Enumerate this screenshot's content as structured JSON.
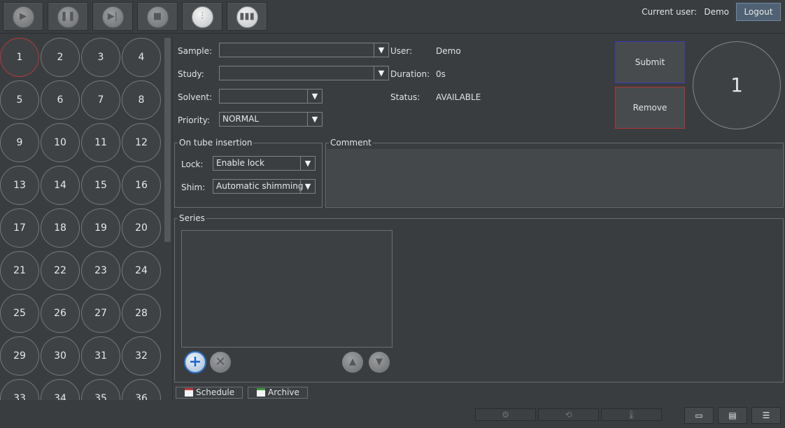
{
  "toolbar": {
    "buttons": [
      {
        "name": "play-button",
        "icon": "play-icon",
        "glyph": "▶",
        "active": false
      },
      {
        "name": "pause-button",
        "icon": "pause-icon",
        "glyph": "❚❚",
        "active": false
      },
      {
        "name": "next-button",
        "icon": "skip-next-icon",
        "glyph": "▶|",
        "active": false
      },
      {
        "name": "stop-button",
        "icon": "stop-icon",
        "glyph": "■",
        "active": false
      },
      {
        "name": "sliders-button",
        "icon": "sliders-icon",
        "glyph": "⫶",
        "active": true
      },
      {
        "name": "levels-button",
        "icon": "bar-levels-icon",
        "glyph": "▮▮▮",
        "active": true
      }
    ]
  },
  "header": {
    "current_user_label": "Current user:",
    "current_user": "Demo",
    "logout": "Logout"
  },
  "rack": {
    "selected": "1",
    "slots": [
      "1",
      "2",
      "3",
      "4",
      "5",
      "6",
      "7",
      "8",
      "9",
      "10",
      "11",
      "12",
      "13",
      "14",
      "15",
      "16",
      "17",
      "18",
      "19",
      "20",
      "21",
      "22",
      "23",
      "24",
      "25",
      "26",
      "27",
      "28",
      "29",
      "30",
      "31",
      "32",
      "33",
      "34",
      "35",
      "36"
    ]
  },
  "form": {
    "sample_label": "Sample:",
    "sample_value": "",
    "study_label": "Study:",
    "study_value": "",
    "solvent_label": "Solvent:",
    "solvent_value": "",
    "priority_label": "Priority:",
    "priority_value": "NORMAL",
    "user_label": "User:",
    "user_value": "Demo",
    "duration_label": "Duration:",
    "duration_value": "0s",
    "status_label": "Status:",
    "status_value": "AVAILABLE",
    "dropdown_arrow": "▼"
  },
  "actions": {
    "submit": "Submit",
    "remove": "Remove",
    "selected_slot": "1"
  },
  "tube_insertion": {
    "title": "On tube insertion",
    "lock_label": "Lock:",
    "lock_value": "Enable lock",
    "shim_label": "Shim:",
    "shim_value": "Automatic shimming"
  },
  "comment": {
    "title": "Comment",
    "value": ""
  },
  "series": {
    "title": "Series",
    "add_glyph": "+",
    "remove_glyph": "✕",
    "up_glyph": "▲",
    "down_glyph": "▼"
  },
  "tabs": {
    "schedule": "Schedule",
    "archive": "Archive"
  },
  "statusbar": {
    "cells": [
      {
        "name": "sample-changer-status",
        "icon": "gear-icon",
        "glyph": "⚙"
      },
      {
        "name": "lock-status",
        "icon": "lock-icon",
        "glyph": "⟲"
      },
      {
        "name": "temperature-status",
        "icon": "thermometer-icon",
        "glyph": "🌡"
      }
    ],
    "views": [
      {
        "name": "view-monitor-button",
        "icon": "monitor-icon",
        "glyph": "▭"
      },
      {
        "name": "view-split-button",
        "icon": "split-view-icon",
        "glyph": "▤"
      },
      {
        "name": "view-list-button",
        "icon": "list-view-icon",
        "glyph": "☰"
      }
    ]
  },
  "colors": {
    "background": "#3a3d40",
    "submit_border": "#3a3ab8",
    "remove_border": "#b33434",
    "selected_slot_border": "#b73a3a",
    "logout_bg": "#4f6173",
    "add_button": "#2b6fc4"
  }
}
